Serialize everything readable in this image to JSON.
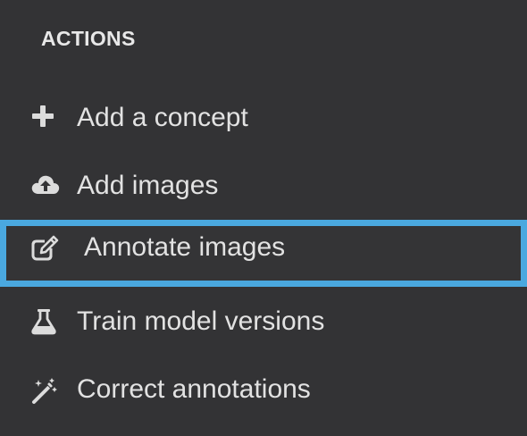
{
  "sidebar": {
    "heading": "ACTIONS",
    "items": [
      {
        "label": "Add a concept",
        "icon": "plus-icon"
      },
      {
        "label": "Add images",
        "icon": "cloud-upload-icon"
      },
      {
        "label": "Annotate images",
        "icon": "edit-icon",
        "selected": true
      },
      {
        "label": "Train model versions",
        "icon": "flask-icon"
      },
      {
        "label": "Correct annotations",
        "icon": "magic-wand-icon"
      }
    ]
  },
  "colors": {
    "background": "#333335",
    "text": "#e2e2e2",
    "selection_border": "#4aa8df"
  }
}
